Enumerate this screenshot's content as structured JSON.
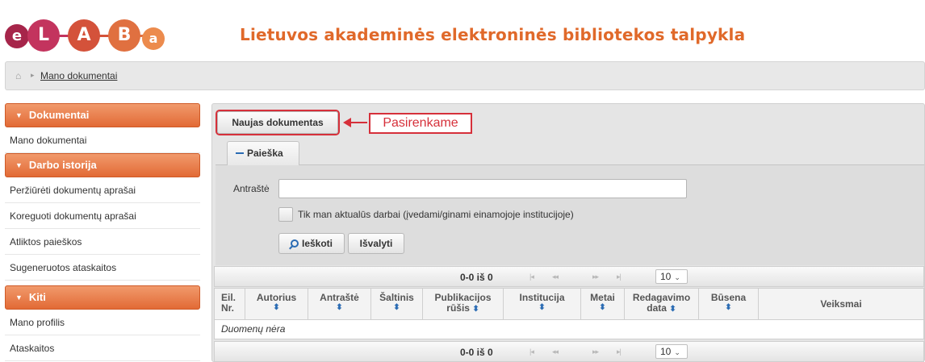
{
  "colors": {
    "accent": "#e26a35",
    "title": "#e0692a",
    "annotation": "#d6303a",
    "link_icon": "#2a6bb3"
  },
  "logo": {
    "letters": [
      "e",
      "L",
      "A",
      "B",
      "a"
    ]
  },
  "site_title": "Lietuvos akademinės elektroninės bibliotekos talpykla",
  "breadcrumb": {
    "home_icon": "home-icon",
    "current": "Mano dokumentai"
  },
  "sidebar": {
    "sections": [
      {
        "title": "Dokumentai",
        "items": [
          "Mano dokumentai"
        ]
      },
      {
        "title": "Darbo istorija",
        "items": [
          "Peržiūrėti dokumentų aprašai",
          "Koreguoti dokumentų aprašai",
          "Atliktos paieškos",
          "Sugeneruotos ataskaitos"
        ]
      },
      {
        "title": "Kiti",
        "items": [
          "Mano profilis",
          "Ataskaitos"
        ]
      }
    ]
  },
  "main": {
    "new_document_button": "Naujas dokumentas",
    "annotation": "Pasirenkame",
    "search_tab": "Paieška",
    "search": {
      "title_label": "Antraštė",
      "title_value": "",
      "checkbox_label": "Tik man aktualūs darbai (įvedami/ginami einamojoje institucijoje)",
      "search_button": "Ieškoti",
      "clear_button": "Išvalyti"
    },
    "pager": {
      "count": "0-0 iš 0",
      "first": "|◂",
      "prev": "◂◂",
      "next": "▸▸",
      "last": "▸|",
      "rows_per_page": "10"
    },
    "table": {
      "headers": [
        {
          "line1": "Eil.",
          "line2": "Nr."
        },
        {
          "line1": "Autorius"
        },
        {
          "line1": "Antraštė"
        },
        {
          "line1": "Šaltinis"
        },
        {
          "line1": "Publikacijos",
          "line2": "rūšis"
        },
        {
          "line1": "Institucija"
        },
        {
          "line1": "Metai"
        },
        {
          "line1": "Redagavimo",
          "line2": "data"
        },
        {
          "line1": "Būsena"
        },
        {
          "line1": "Veiksmai"
        }
      ],
      "empty_text": "Duomenų nėra"
    }
  }
}
